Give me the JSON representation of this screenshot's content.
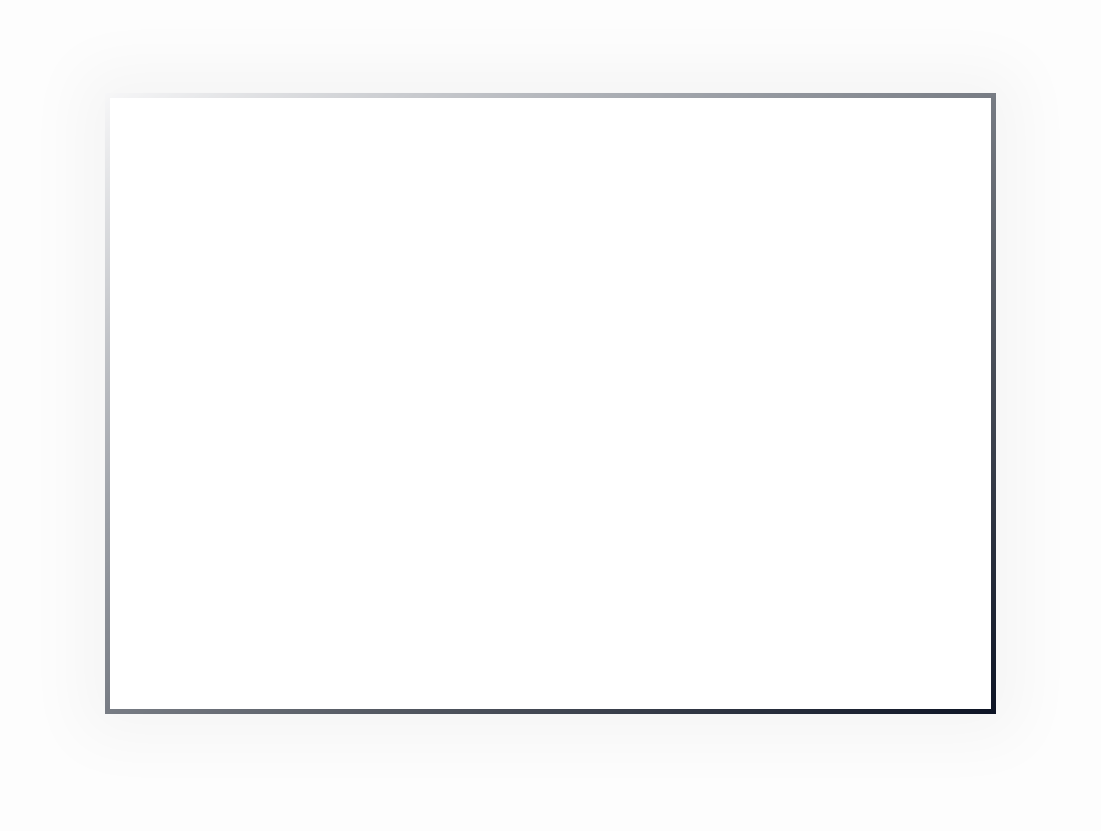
{
  "canvas": {
    "background_color": "#fdfdfd",
    "frame_background_color": "#ffffff",
    "frame_border_gradient": [
      "#f7f7f8",
      "#9a9ea5",
      "#555a63",
      "#0d1425"
    ]
  }
}
